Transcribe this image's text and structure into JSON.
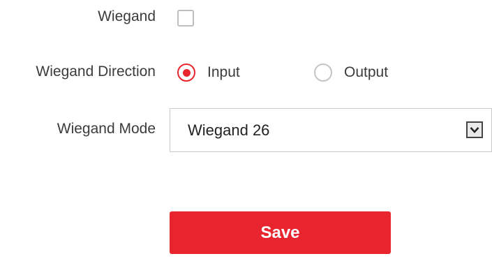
{
  "form": {
    "wiegand": {
      "label": "Wiegand",
      "checked": false
    },
    "direction": {
      "label": "Wiegand Direction",
      "selected": "Input",
      "options": [
        {
          "label": "Input",
          "checked": true
        },
        {
          "label": "Output",
          "checked": false
        }
      ]
    },
    "mode": {
      "label": "Wiegand Mode",
      "value": "Wiegand 26"
    },
    "save_label": "Save"
  },
  "colors": {
    "accent": "#e8252f",
    "text": "#3b3b3b",
    "border": "#c9c9c9"
  },
  "icons": {
    "radio_checked": "radio-checked-icon",
    "radio_unchecked": "radio-unchecked-icon",
    "dropdown": "chevron-down-icon"
  }
}
